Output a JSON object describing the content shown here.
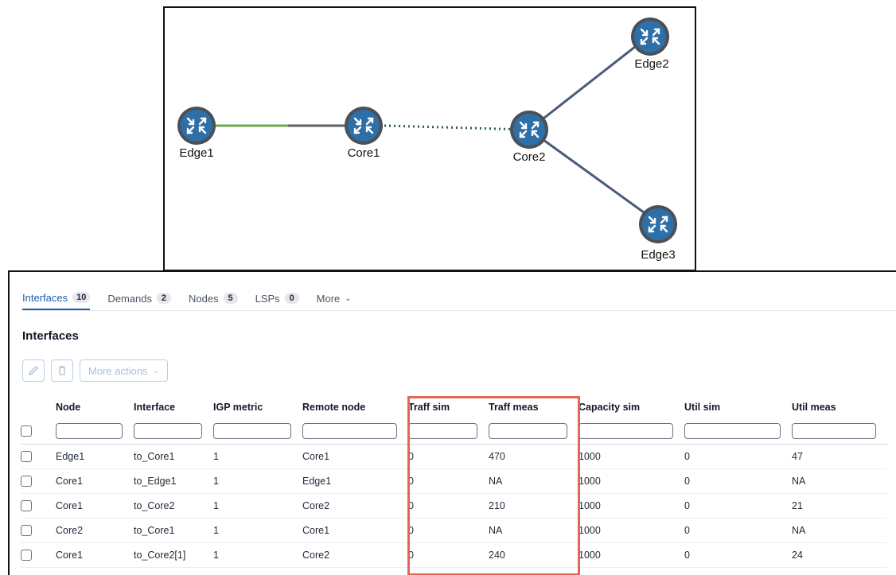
{
  "topology": {
    "nodes": [
      {
        "id": "Edge1",
        "label": "Edge1"
      },
      {
        "id": "Core1",
        "label": "Core1"
      },
      {
        "id": "Core2",
        "label": "Core2"
      },
      {
        "id": "Edge2",
        "label": "Edge2"
      },
      {
        "id": "Edge3",
        "label": "Edge3"
      }
    ],
    "links": [
      {
        "from": "Edge1",
        "to": "Core1",
        "style": "split-green-gray"
      },
      {
        "from": "Core1",
        "to": "Core2",
        "style": "dotted-green"
      },
      {
        "from": "Core2",
        "to": "Edge2",
        "style": "solid-slate"
      },
      {
        "from": "Core2",
        "to": "Edge3",
        "style": "solid-slate"
      }
    ],
    "node_icon": "router-arrows-icon",
    "colors": {
      "node_fill": "#2f6fa8",
      "node_ring": "#4a5058",
      "link_green": "#6aa84f",
      "link_gray": "#5a5f66",
      "link_slate": "#4a5a7a",
      "dotted": "#2f5d4a"
    }
  },
  "tabs": [
    {
      "label": "Interfaces",
      "count": "10",
      "active": true
    },
    {
      "label": "Demands",
      "count": "2"
    },
    {
      "label": "Nodes",
      "count": "5"
    },
    {
      "label": "LSPs",
      "count": "0"
    },
    {
      "label": "More",
      "chevron": "chevron-down-icon"
    }
  ],
  "section_title": "Interfaces",
  "toolbar": {
    "more_actions": "More actions"
  },
  "table": {
    "columns": [
      "Node",
      "Interface",
      "IGP metric",
      "Remote node",
      "Traff sim",
      "Traff meas",
      "Capacity sim",
      "Util sim",
      "Util meas"
    ],
    "rows": [
      [
        "Edge1",
        "to_Core1",
        "1",
        "Core1",
        "0",
        "470",
        "1000",
        "0",
        "47"
      ],
      [
        "Core1",
        "to_Edge1",
        "1",
        "Edge1",
        "0",
        "NA",
        "1000",
        "0",
        "NA"
      ],
      [
        "Core1",
        "to_Core2",
        "1",
        "Core2",
        "0",
        "210",
        "1000",
        "0",
        "21"
      ],
      [
        "Core2",
        "to_Core1",
        "1",
        "Core1",
        "0",
        "NA",
        "1000",
        "0",
        "NA"
      ],
      [
        "Core1",
        "to_Core2[1]",
        "1",
        "Core2",
        "0",
        "240",
        "1000",
        "0",
        "24"
      ]
    ]
  },
  "highlight_color": "#e06655"
}
